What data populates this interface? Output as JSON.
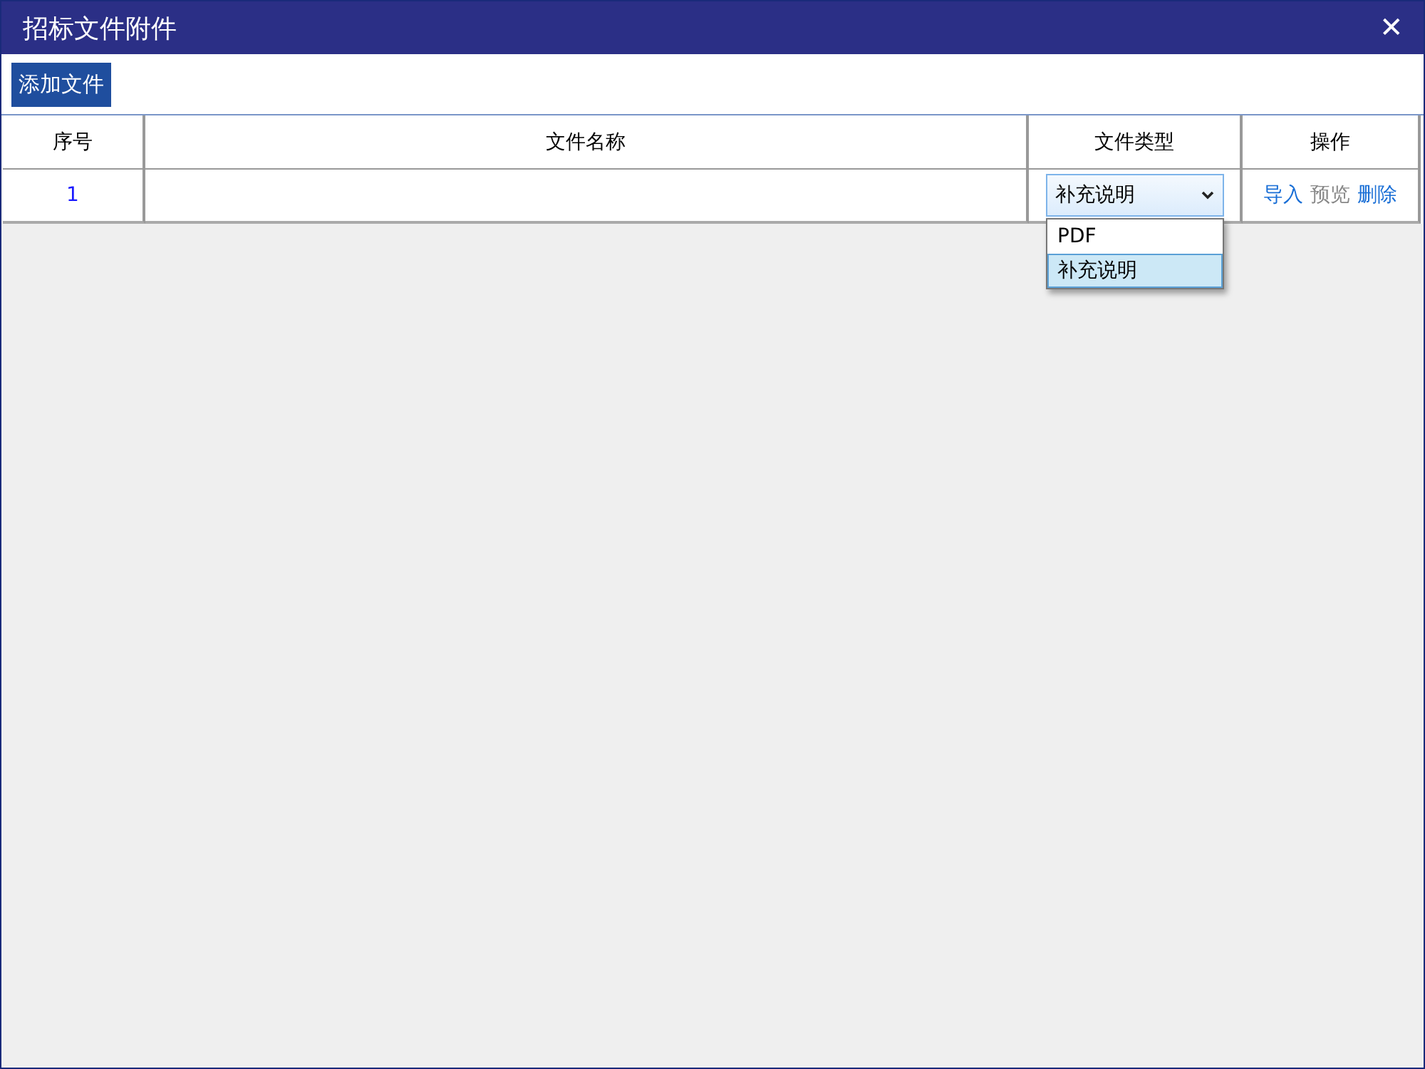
{
  "window": {
    "title": "招标文件附件",
    "close": "✕"
  },
  "toolbar": {
    "buttons": [
      "添加文件"
    ]
  },
  "table": {
    "columns": [
      "序号",
      "文件名称",
      "文件类型",
      "操作"
    ],
    "rows": [
      {
        "index": "1",
        "type_select": {
          "value": "补充说明",
          "expanded": true,
          "options": [
            {
              "label": "PDF",
              "selected": false
            },
            {
              "label": "补充说明",
              "selected": true
            }
          ]
        },
        "actions": [
          {
            "label": "导入",
            "disabled": false
          },
          {
            "label": "预览",
            "disabled": true
          },
          {
            "label": "删除",
            "disabled": false
          }
        ]
      }
    ]
  }
}
